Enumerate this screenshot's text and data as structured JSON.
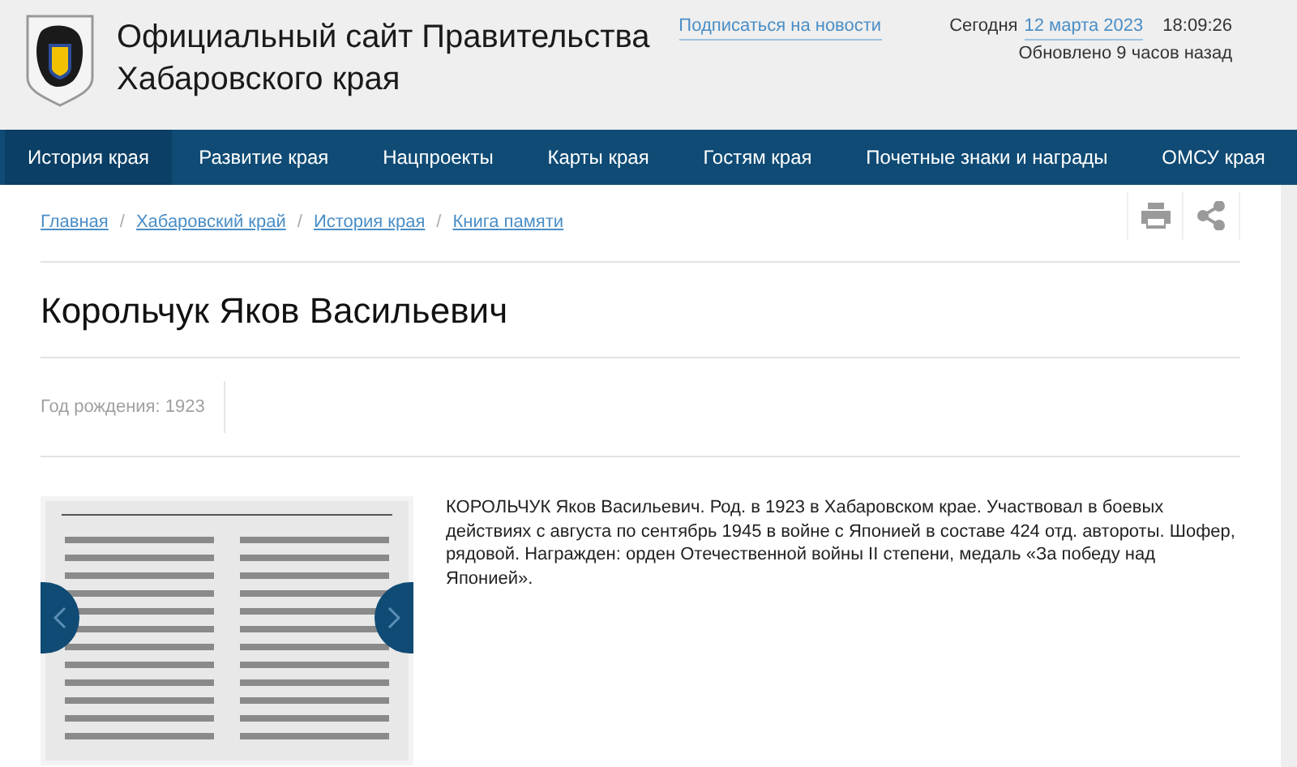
{
  "header": {
    "title_lines": [
      "Официальный сайт Правительства",
      "Хабаровского края"
    ],
    "subscribe_link": "Подписаться на новости",
    "today_label": "Сегодня",
    "today_date": "12 марта 2023",
    "time": "18:09:26",
    "updated": "Обновлено 9 часов назад"
  },
  "nav": [
    {
      "label": "История края",
      "selected": true
    },
    {
      "label": "Развитие края",
      "selected": false
    },
    {
      "label": "Нацпроекты",
      "selected": false
    },
    {
      "label": "Карты края",
      "selected": false
    },
    {
      "label": "Гостям края",
      "selected": false
    },
    {
      "label": "Почетные знаки и награды",
      "selected": false
    },
    {
      "label": "ОМСУ края",
      "selected": false
    }
  ],
  "breadcrumbs": [
    "Главная",
    "Хабаровский край",
    "История края",
    "Книга памяти"
  ],
  "breadcrumb_separator": "/",
  "page_title": "Корольчук Яков Васильевич",
  "birth_year": "Год рождения: 1923",
  "biography": "КОРОЛЬЧУК Яков Васильевич. Род. в 1923 в Хабаровском крае. Участвовал в боевых действиях с августа по сентябрь 1945 в войне с Японией в составе 424 отд. автороты. Шофер, рядовой. Награжден: орден Отечественной войны II степени, медаль «За победу над Японией»."
}
